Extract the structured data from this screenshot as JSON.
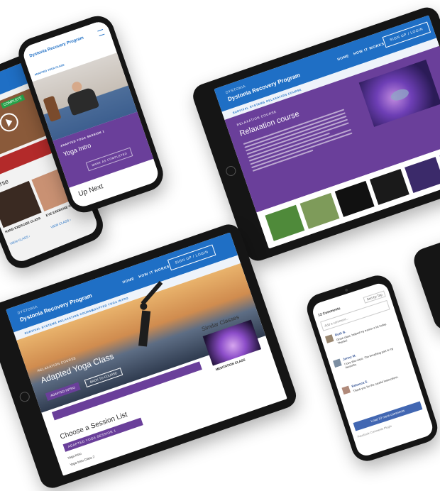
{
  "brand": {
    "tagline": "DYSTONIA",
    "name": "Dystonia Recovery Program"
  },
  "nav": {
    "home": "HOME",
    "how_it_works": "HOW IT WORKS",
    "signup": "SIGN UP / LOGIN",
    "account": "Recovery Program"
  },
  "breadcrumbs": {
    "b1": "SURVIVAL SYSTEMS",
    "b2": "RELAXATION COURSE",
    "b3": "ADAPTED YOGA INTRO"
  },
  "relaxation": {
    "kicker": "RELAXATION COURSE",
    "title": "Relaxation course"
  },
  "yoga_tablet": {
    "kicker": "RELAXATION COURSE",
    "title": "Adapted Yoga Class",
    "btn_intro": "ADAPTED INTRO",
    "btn_start": "BACK TO COURSE",
    "similar": "Similar Classes",
    "meditation": "MEDITATION CLASS",
    "session_title": "Choose a Session List",
    "session_btn": "ADAPTED YOGA SESSION 1",
    "session_item1": "Yoga Intro",
    "session_item2": "Yoga Intro Class 2"
  },
  "phone_yoga": {
    "kicker": "ADAPTED YOGA SESSION 1",
    "title": "Yoga Intro",
    "mark": "MARK AS COMPLETED",
    "up_next": "Up Next",
    "crumb": "ADAPTED YOGA CLASS"
  },
  "phone_left": {
    "badge": "COMPLETE",
    "course": "course",
    "c1": "HAND EXERCISE CLASS",
    "c2": "EYE EXERCISE CLASS",
    "view": "VIEW CLASS ›"
  },
  "phone_comments": {
    "count": "12 Comments",
    "sort": "Sort by Top",
    "placeholder": "Add a comment...",
    "c1_name": "Ruth B.",
    "c1_text": "Great class, helped my tremor a lot today. Thanks!",
    "c2_name": "Jenny M.",
    "c2_text": "I love this class. The breathing part is my favourite.",
    "c3_name": "Rebecca S.",
    "c3_text": "Thank you for the careful instructions.",
    "more": "Load 10 more comments",
    "plugin": "Facebook Comments Plugin"
  }
}
